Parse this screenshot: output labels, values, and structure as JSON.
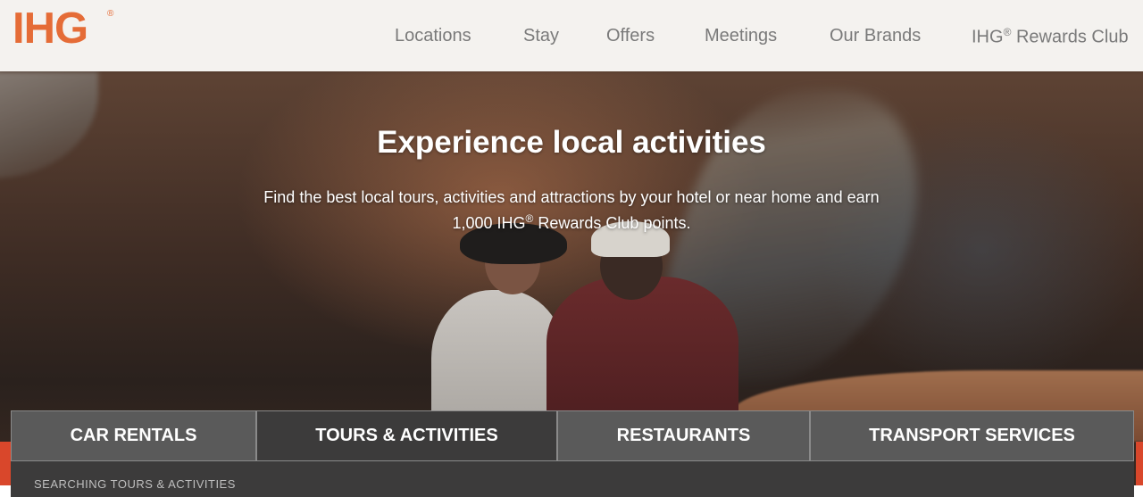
{
  "brand": {
    "logo": "IHG",
    "logo_mark": "®",
    "color": "#e56c37"
  },
  "nav": {
    "items": [
      {
        "label": "Locations"
      },
      {
        "label": "Stay"
      },
      {
        "label": "Offers"
      },
      {
        "label": "Meetings"
      },
      {
        "label": "Our Brands"
      },
      {
        "label_prefix": "IHG",
        "label_mark": "®",
        "label_suffix": " Rewards Club"
      }
    ]
  },
  "hero": {
    "title": "Experience local activities",
    "subtitle_line1": "Find the best local tours, activities and attractions by your hotel or near home and earn",
    "subtitle_line2_prefix": "1,000 IHG",
    "subtitle_line2_mark": "®",
    "subtitle_line2_suffix": " Rewards Club points."
  },
  "tabs": [
    {
      "label": "CAR RENTALS",
      "active": false
    },
    {
      "label": "TOURS & ACTIVITIES",
      "active": true
    },
    {
      "label": "RESTAURANTS",
      "active": false
    },
    {
      "label": "TRANSPORT SERVICES",
      "active": false
    }
  ],
  "search_panel": {
    "label": "SEARCHING TOURS & ACTIVITIES"
  },
  "colors": {
    "header_bg": "#f4f2ef",
    "tab_bg": "#5a5a5a",
    "tab_active_bg": "#3c3b3b",
    "accent_red": "#d9472b"
  }
}
